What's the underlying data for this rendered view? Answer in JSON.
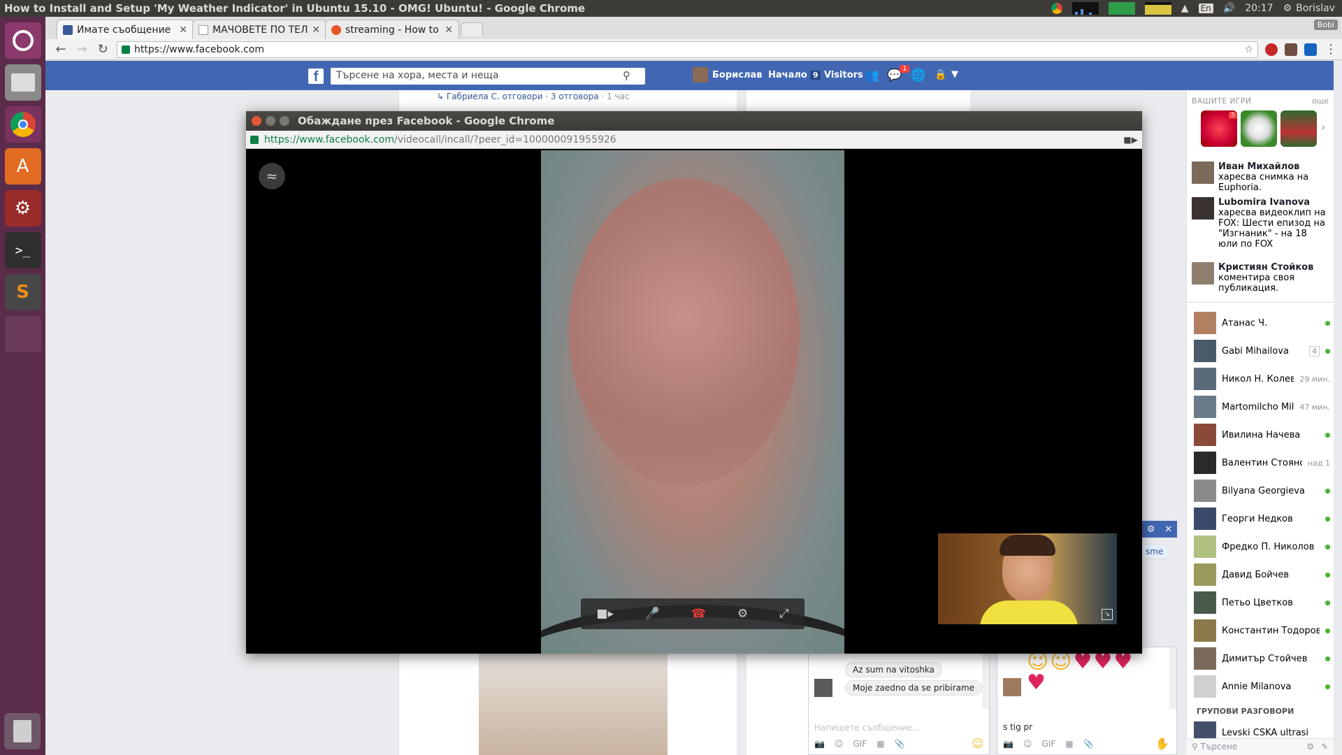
{
  "desktop": {
    "window_title": "How to Install and Setup 'My Weather Indicator' in Ubuntu 15.10 - OMG! Ubuntu! - Google Chrome",
    "tray": {
      "keyboard": "En",
      "time": "20:17",
      "user": "Borislav"
    }
  },
  "launcher": {
    "items": [
      "ubuntu-dash-icon",
      "files-icon",
      "chrome-icon",
      "software-center-icon",
      "settings-icon",
      "terminal-icon",
      "sublime-icon",
      "workspaces-icon",
      "trash-icon"
    ]
  },
  "chrome": {
    "profile_badge": "Bobi",
    "tabs": [
      {
        "label": "Имате съобщение",
        "favicon_color": "#3b5998"
      },
      {
        "label": "МАЧОВЕТЕ ПО ТЕЛ",
        "favicon_color": "#9e9e9e"
      },
      {
        "label": "streaming - How to",
        "favicon_color": "#e8542a"
      }
    ],
    "url": "https://www.facebook.com"
  },
  "facebook": {
    "search_placeholder": "Търсене на хора, места и неща",
    "nav": {
      "profile": "Борислав",
      "home": "Начало",
      "home_count": "9",
      "visitors": "Visitors",
      "messages_count": "1"
    },
    "reply_line": {
      "text": "Габриела С. отговори · 3 отговора",
      "time": " · 1 час"
    },
    "games_header": "ВАШИТЕ ИГРИ",
    "games_more": "още",
    "game_badge": "5",
    "ticker": [
      {
        "name": "Иван Михайлов",
        "text": " харесва снимка на Euphoria."
      },
      {
        "name": "Lubomira Ivanova",
        "text": " харесва видеоклип на FOX: Шести епизод на \"Изгнаник\" - на 18 юли по FOX"
      },
      {
        "name": "Кристиян Стойков",
        "text": " коментира своя публикация."
      }
    ],
    "contacts": [
      {
        "name": "Атанас Ч.",
        "status": "",
        "online": true
      },
      {
        "name": "Gabi Mihailova",
        "status": "4",
        "online": true
      },
      {
        "name": "Никол Н. Колева",
        "status": "29 мин.",
        "online": false
      },
      {
        "name": "Martomilcho Mil...",
        "status": "47 мин.",
        "online": false
      },
      {
        "name": "Ивилина Начева",
        "status": "",
        "online": true
      },
      {
        "name": "Валентин Стоянов",
        "status": "над 1",
        "online": false
      },
      {
        "name": "Bilyana Georgieva",
        "status": "",
        "online": true
      },
      {
        "name": "Георги Недков",
        "status": "",
        "online": true
      },
      {
        "name": "Фредко П. Николов",
        "status": "",
        "online": true
      },
      {
        "name": "Давид Бойчев",
        "status": "",
        "online": true
      },
      {
        "name": "Петьо Цветков",
        "status": "",
        "online": true
      },
      {
        "name": "Константин Тодоров",
        "status": "",
        "online": true
      },
      {
        "name": "Димитър Стойчев",
        "status": "",
        "online": true
      },
      {
        "name": "Annie Milanova",
        "status": "",
        "online": true
      }
    ],
    "group_header": "ГРУПОВИ РАЗГОВОРИ",
    "group_item": "Levski CSKA ultrasi",
    "sidebar_search": "Търсене",
    "chat1": {
      "messages": [
        "Az sum na vitoshka",
        "Moje zaedno da se pribirame"
      ],
      "input_placeholder": "Напишете съобщение...",
      "tools": [
        "camera-icon",
        "smiley-icon",
        "GIF",
        "sticker-icon",
        "attach-icon"
      ]
    },
    "chat2": {
      "input_value": "s tig pr",
      "partial_bubble": "sme"
    }
  },
  "popup": {
    "title": "Обаждане през Facebook - Google Chrome",
    "url_host": "https://www.facebook.com",
    "url_path": "/videocall/incall/?peer_id=100000091955926",
    "controls": [
      "video-camera-icon",
      "microphone-icon",
      "hang-up-icon",
      "settings-icon",
      "fullscreen-icon"
    ]
  }
}
